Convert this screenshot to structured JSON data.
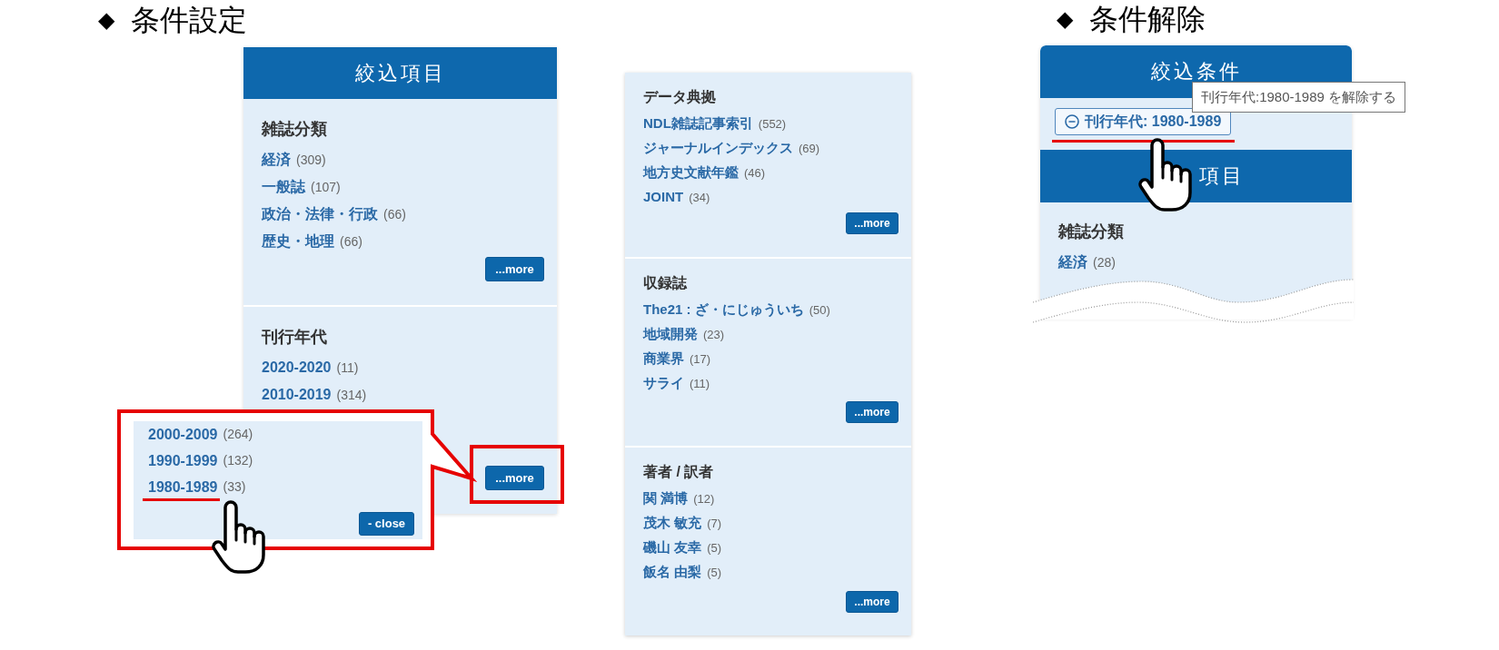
{
  "condition_setting": {
    "heading": {
      "marker": "◆",
      "text": "条件設定"
    },
    "panel": {
      "title": "絞込項目",
      "groups": [
        {
          "title": "雑誌分類",
          "items": [
            {
              "label": "経済",
              "count": "(309)"
            },
            {
              "label": "一般誌",
              "count": "(107)"
            },
            {
              "label": "政治・法律・行政",
              "count": "(66)"
            },
            {
              "label": "歴史・地理",
              "count": "(66)"
            }
          ],
          "more": {
            "label": "...more",
            "highlighted": false
          }
        },
        {
          "title": "刊行年代",
          "items": [
            {
              "label": "2020-2020",
              "count": "(11)"
            },
            {
              "label": "2010-2019",
              "count": "(314)"
            }
          ],
          "more": {
            "label": "...more",
            "highlighted": true
          }
        }
      ]
    },
    "expanded_list": {
      "items": [
        {
          "label": "2000-2009",
          "count": "(264)",
          "highlighted": false
        },
        {
          "label": "1990-1999",
          "count": "(132)",
          "highlighted": false
        },
        {
          "label": "1980-1989",
          "count": "(33)",
          "highlighted": true
        }
      ],
      "close": "- close"
    }
  },
  "facet_panel": {
    "groups": [
      {
        "title": "データ典拠",
        "items": [
          {
            "label": "NDL雑誌記事索引",
            "count": "(552)"
          },
          {
            "label": "ジャーナルインデックス",
            "count": "(69)"
          },
          {
            "label": "地方史文献年鑑",
            "count": "(46)"
          },
          {
            "label": "JOINT",
            "count": "(34)"
          }
        ],
        "more": {
          "label": "...more",
          "highlighted": false
        }
      },
      {
        "title": "収録誌",
        "items": [
          {
            "label": "The21 : ざ・にじゅういち",
            "count": "(50)"
          },
          {
            "label": "地域開発",
            "count": "(23)"
          },
          {
            "label": "商業界",
            "count": "(17)"
          },
          {
            "label": "サライ",
            "count": "(11)"
          }
        ],
        "more": {
          "label": "...more",
          "highlighted": false
        }
      },
      {
        "title": "著者 / 訳者",
        "items": [
          {
            "label": "関 満博",
            "count": "(12)"
          },
          {
            "label": "茂木 敏充",
            "count": "(7)"
          },
          {
            "label": "磯山 友幸",
            "count": "(5)"
          },
          {
            "label": "飯名 由梨",
            "count": "(5)"
          }
        ],
        "more": {
          "label": "...more",
          "highlighted": false
        }
      }
    ]
  },
  "condition_removal": {
    "heading": {
      "marker": "◆",
      "text": "条件解除"
    },
    "panel": {
      "title": "絞込条件",
      "active_filters": [
        {
          "label": "刊行年代: 1980-1989",
          "highlighted": true
        }
      ],
      "tooltip": "刊行年代:1980-1989 を解除する",
      "items_title": "項目",
      "groups": [
        {
          "title": "雑誌分類",
          "items": [
            {
              "label": "経済",
              "count": "(28)"
            }
          ]
        }
      ]
    }
  }
}
